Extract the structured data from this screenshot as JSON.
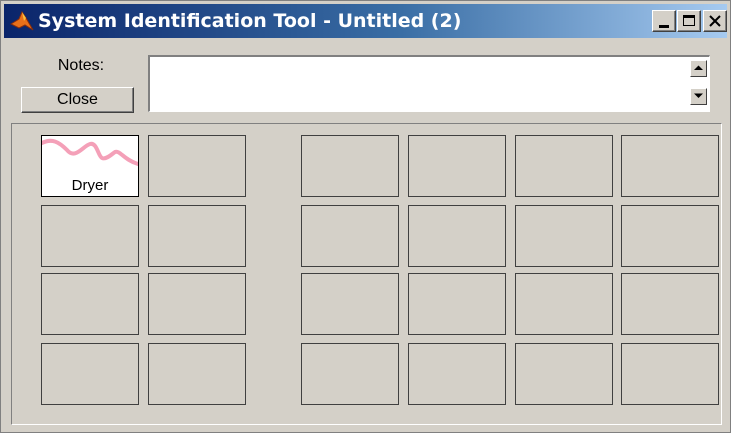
{
  "window": {
    "title": "System Identification Tool - Untitled (2)",
    "title_icon": "matlab-logo-icon",
    "controls": [
      "minimize-icon",
      "maximize-icon",
      "close-icon"
    ]
  },
  "notes": {
    "label": "Notes:",
    "value": "",
    "close_label": "Close"
  },
  "board": {
    "data_tile": {
      "label": "Dryer",
      "curve_color": "#f4a0b8"
    }
  },
  "colors": {
    "face": "#d4d0c8",
    "title_start": "#0a246a",
    "title_end": "#a6caf0"
  }
}
